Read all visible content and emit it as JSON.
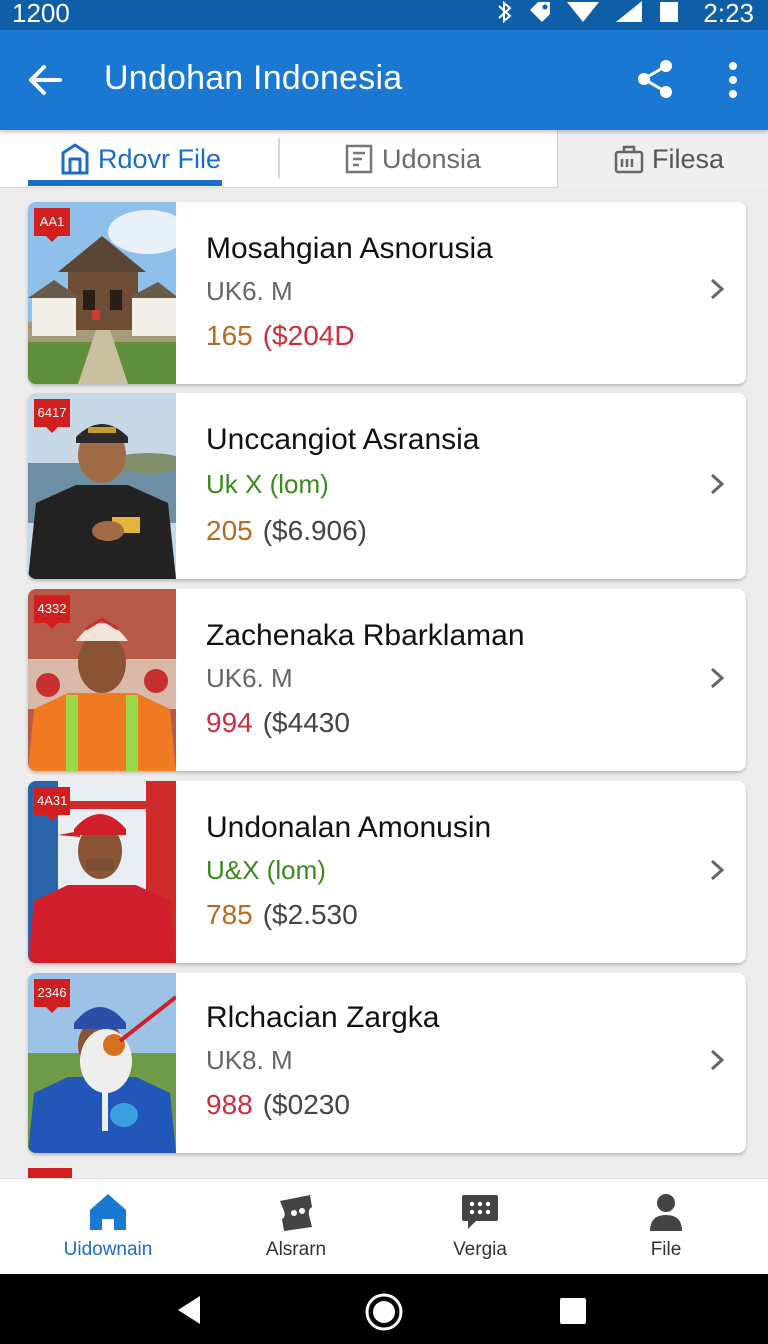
{
  "status_bar": {
    "left_text": "1200",
    "time": "2:23"
  },
  "app_bar": {
    "title": "Undohan Indonesia"
  },
  "tabs": [
    {
      "label": "Rdovr File",
      "icon": "building-icon",
      "active": true
    },
    {
      "label": "Udonsia",
      "icon": "document-icon",
      "active": false
    },
    {
      "label": "Filesa",
      "icon": "briefcase-icon",
      "active": false
    }
  ],
  "items": [
    {
      "badge": "AA1",
      "title": "Mosahgian Asnorusia",
      "subtitle": "UK6. M",
      "subtitle_color": "#666666",
      "price": "165",
      "price_color": "orange",
      "amount": "($204D",
      "amount_color": "#cc2e3b",
      "image": "house-photo"
    },
    {
      "badge": "6417",
      "title": "Unccangiot Asransia",
      "subtitle": "Uk X (lom)",
      "subtitle_color": "#3a8a1a",
      "price": "205",
      "price_color": "orange",
      "amount": "($6.906)",
      "amount_color": "#444444",
      "image": "man-cap-photo"
    },
    {
      "badge": "4332",
      "title": "Zachenaka Rbarklaman",
      "subtitle": "UK6. M",
      "subtitle_color": "#666666",
      "price": "994",
      "price_color": "red",
      "amount": "($4430",
      "amount_color": "#444444",
      "image": "worker-photo"
    },
    {
      "badge": "4A31",
      "title": "Undonalan Amonusin",
      "subtitle": "U&X (lom)",
      "subtitle_color": "#3a8a1a",
      "price": "785",
      "price_color": "orange",
      "amount": "($2.530",
      "amount_color": "#444444",
      "image": "red-cap-photo"
    },
    {
      "badge": "2346",
      "title": "Rlchacian Zargka",
      "subtitle": "UK8. M",
      "subtitle_color": "#666666",
      "price": "988",
      "price_color": "red",
      "amount": "($0230",
      "amount_color": "#444444",
      "image": "blue-cap-photo"
    }
  ],
  "bottom_nav": [
    {
      "label": "Uidownain",
      "icon": "home-icon",
      "active": true
    },
    {
      "label": "Alsrarn",
      "icon": "ticket-icon",
      "active": false
    },
    {
      "label": "Vergia",
      "icon": "chat-icon",
      "active": false
    },
    {
      "label": "File",
      "icon": "person-icon",
      "active": false
    }
  ],
  "colors": {
    "primary": "#1a78d2",
    "status_bar": "#0f5ea8",
    "accent_blue": "#1a6cc9",
    "badge_red": "#d11f1f",
    "price_orange": "#b86a1e",
    "price_red": "#cc2e3b"
  }
}
